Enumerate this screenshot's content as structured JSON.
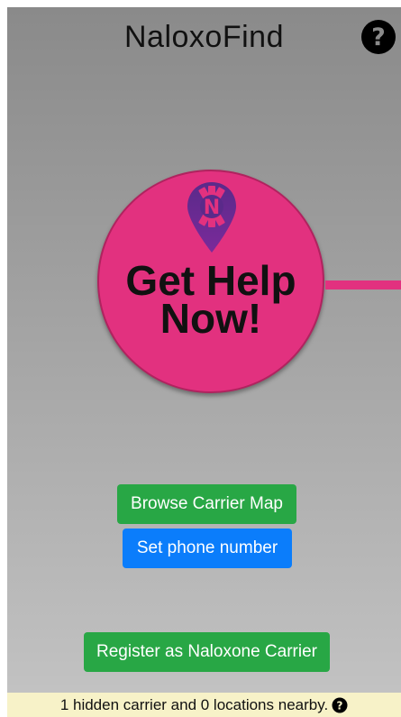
{
  "app": {
    "title": "NaloxoFind"
  },
  "header": {
    "help_icon": "question-circle-icon"
  },
  "emergency": {
    "button_label": "Get Help Now!",
    "icon": "naloxone-pin-icon",
    "color": "#e2317f"
  },
  "actions": {
    "browse_map_label": "Browse Carrier Map",
    "set_phone_label": "Set phone number",
    "register_label": "Register as Naloxone Carrier"
  },
  "status": {
    "message": "1 hidden carrier and 0 locations nearby.",
    "info_icon": "question-circle-icon"
  },
  "colors": {
    "success": "#28a745",
    "primary": "#0b7dfb",
    "status_bg": "#f7f2c8"
  }
}
